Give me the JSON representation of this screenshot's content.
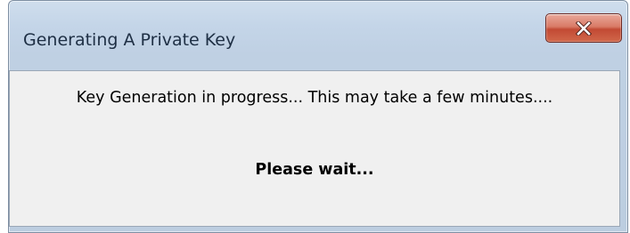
{
  "window": {
    "title": "Generating A Private Key"
  },
  "close_button": {
    "icon": "close-icon",
    "color": "#c24a34"
  },
  "dialog": {
    "message": "Key Generation in progress... This may take a few minutes....",
    "status": "Please wait..."
  }
}
